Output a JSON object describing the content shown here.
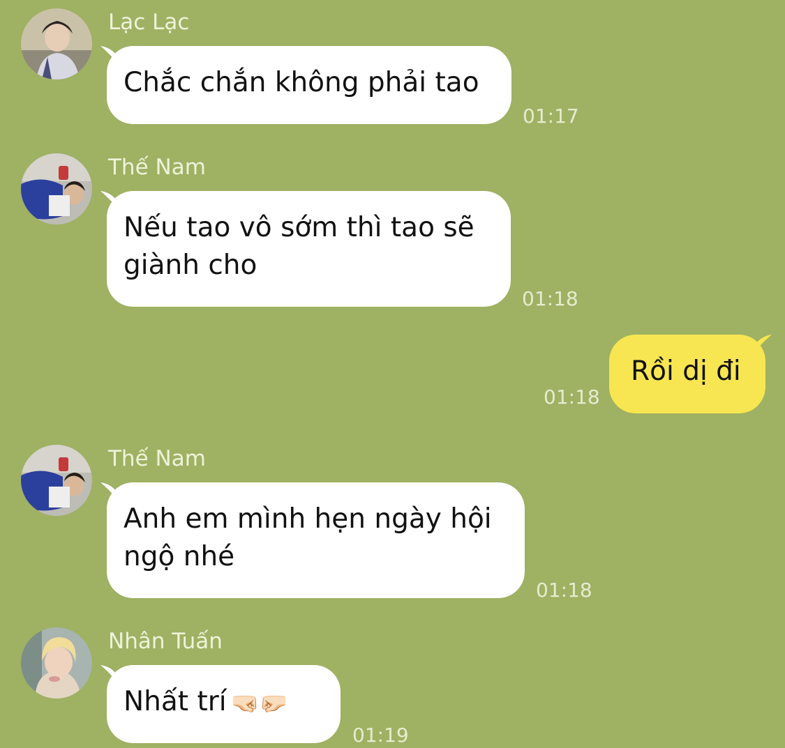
{
  "messages": [
    {
      "sender": "Lạc Lạc",
      "text": "Chắc chắn không phải tao",
      "time": "01:17",
      "direction": "incoming",
      "avatar": "lac-lac-avatar"
    },
    {
      "sender": "Thế Nam",
      "text": "Nếu tao vô sớm thì tao sẽ giành cho",
      "time": "01:18",
      "direction": "incoming",
      "avatar": "the-nam-avatar"
    },
    {
      "sender": "",
      "text": "Rồi dị đi",
      "time": "01:18",
      "direction": "outgoing"
    },
    {
      "sender": "Thế Nam",
      "text": "Anh em mình hẹn ngày hội ngộ nhé",
      "time": "01:18",
      "direction": "incoming",
      "avatar": "the-nam-avatar"
    },
    {
      "sender": "Nhân Tuấn",
      "text": "Nhất trí",
      "emoji": "🤜🏻🤛🏻",
      "time": "01:19",
      "direction": "incoming",
      "avatar": "nhan-tuan-avatar"
    }
  ],
  "colors": {
    "background": "#9fb163",
    "incoming_bubble": "#ffffff",
    "outgoing_bubble": "#f7e651",
    "sender_name": "#eef3d9",
    "timestamp": "#e6ecd0"
  }
}
